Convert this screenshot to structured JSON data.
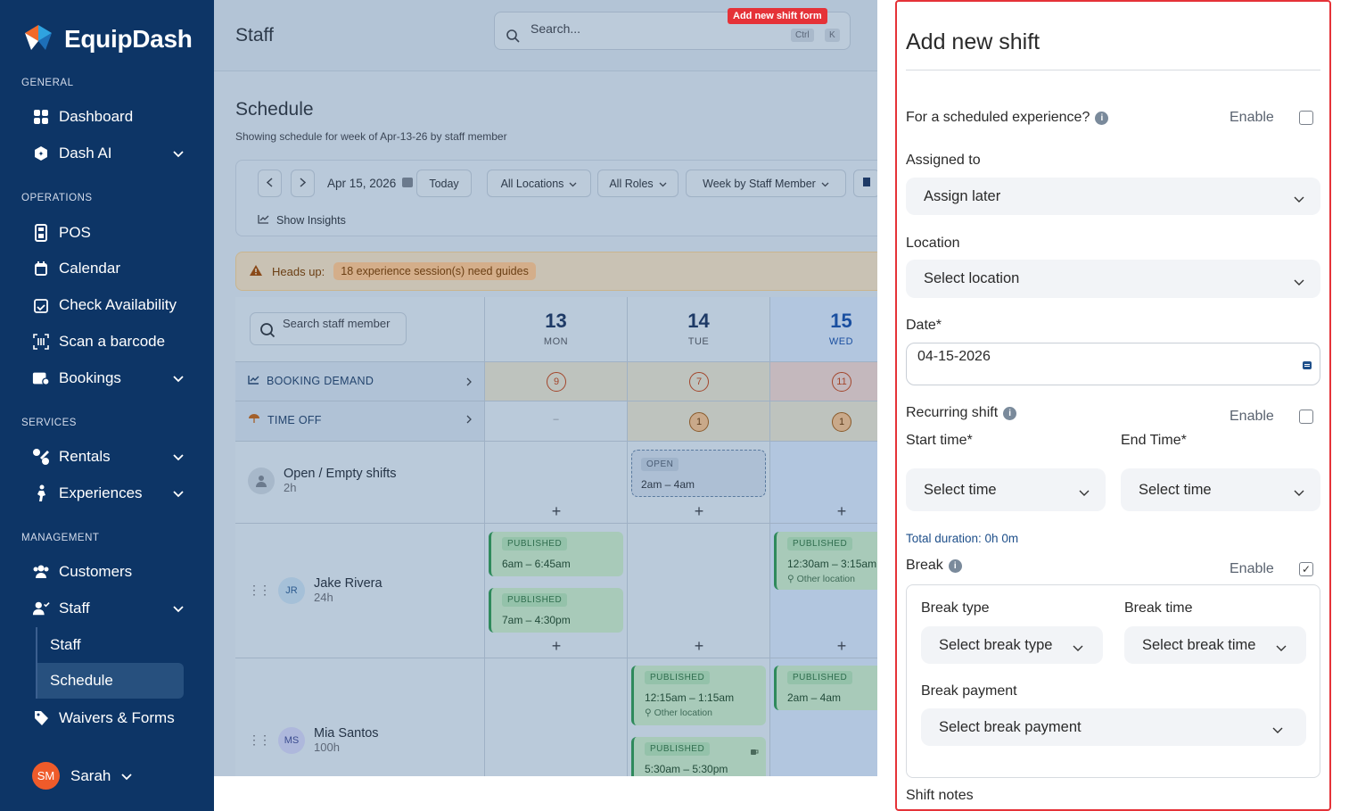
{
  "app": {
    "name": "EquipDash"
  },
  "sidebar": {
    "sections": [
      "GENERAL",
      "OPERATIONS",
      "SERVICES",
      "MANAGEMENT"
    ],
    "items": [
      {
        "label": "Dashboard",
        "icon": "grid-icon"
      },
      {
        "label": "Dash AI",
        "icon": "ai-icon"
      },
      {
        "label": "POS",
        "icon": "pos-icon"
      },
      {
        "label": "Calendar",
        "icon": "calendar-icon"
      },
      {
        "label": "Check Availability",
        "icon": "calendar-check-icon"
      },
      {
        "label": "Scan a barcode",
        "icon": "barcode-icon"
      },
      {
        "label": "Bookings",
        "icon": "bookings-icon"
      },
      {
        "label": "Rentals",
        "icon": "rentals-icon"
      },
      {
        "label": "Experiences",
        "icon": "experiences-icon"
      },
      {
        "label": "Customers",
        "icon": "customers-icon"
      },
      {
        "label": "Staff",
        "icon": "staff-icon"
      },
      {
        "label": "Waivers & Forms",
        "icon": "tag-icon"
      }
    ],
    "sub_items": [
      "Staff",
      "Schedule"
    ],
    "user": {
      "initials": "SM",
      "name": "Sarah"
    }
  },
  "topbar": {
    "title": "Staff",
    "search_placeholder": "Search...",
    "kbd1": "Ctrl",
    "kbd2": "K"
  },
  "annotation": {
    "label": "Add new shift form"
  },
  "schedule": {
    "title": "Schedule",
    "subtitle": "Showing schedule for week of Apr-13-26 by staff member",
    "date": "Apr 15, 2026",
    "today": "Today",
    "locations": "All Locations",
    "roles": "All Roles",
    "view": "Week by Staff Member",
    "insights": "Show Insights",
    "headsup_label": "Heads up:",
    "headsup_msg": "18 experience session(s) need guides",
    "search_staff": "Search staff member",
    "booking_demand": "BOOKING DEMAND",
    "time_off": "TIME OFF",
    "days": [
      {
        "num": "13",
        "name": "MON",
        "demand": "9",
        "timeoff": "–"
      },
      {
        "num": "14",
        "name": "TUE",
        "demand": "7",
        "timeoff": "1"
      },
      {
        "num": "15",
        "name": "WED",
        "demand": "11",
        "timeoff": "1"
      }
    ],
    "open_shifts": {
      "name": "Open / Empty shifts",
      "hours": "2h",
      "badge": "OPEN",
      "time": "2am – 4am"
    },
    "staff": [
      {
        "initials": "JR",
        "name": "Jake Rivera",
        "hours": "24h"
      },
      {
        "initials": "MS",
        "name": "Mia Santos",
        "hours": "100h"
      }
    ],
    "published": "PUBLISHED",
    "other_location": "Other location",
    "shifts": {
      "jr_mon1": "6am – 6:45am",
      "jr_mon2": "7am – 4:30pm",
      "jr_wed1": "12:30am – 3:15am",
      "ms_tue1": "12:15am – 1:15am",
      "ms_tue2": "5:30am – 5:30pm",
      "ms_wed1": "2am – 4am"
    }
  },
  "form": {
    "title": "Add new shift",
    "scheduled_exp": "For a scheduled experience?",
    "enable": "Enable",
    "assigned_to": "Assigned to",
    "assigned_value": "Assign later",
    "location": "Location",
    "location_value": "Select location",
    "date": "Date*",
    "date_value": "04-15-2026",
    "recurring": "Recurring shift",
    "start_time": "Start time*",
    "end_time": "End Time*",
    "select_time": "Select time",
    "total_duration": "Total duration: 0h 0m",
    "break": "Break",
    "break_checked": true,
    "break_type": "Break type",
    "break_type_value": "Select break type",
    "break_time": "Break time",
    "break_time_value": "Select break time",
    "break_payment": "Break payment",
    "break_payment_value": "Select break payment",
    "shift_notes": "Shift notes"
  }
}
